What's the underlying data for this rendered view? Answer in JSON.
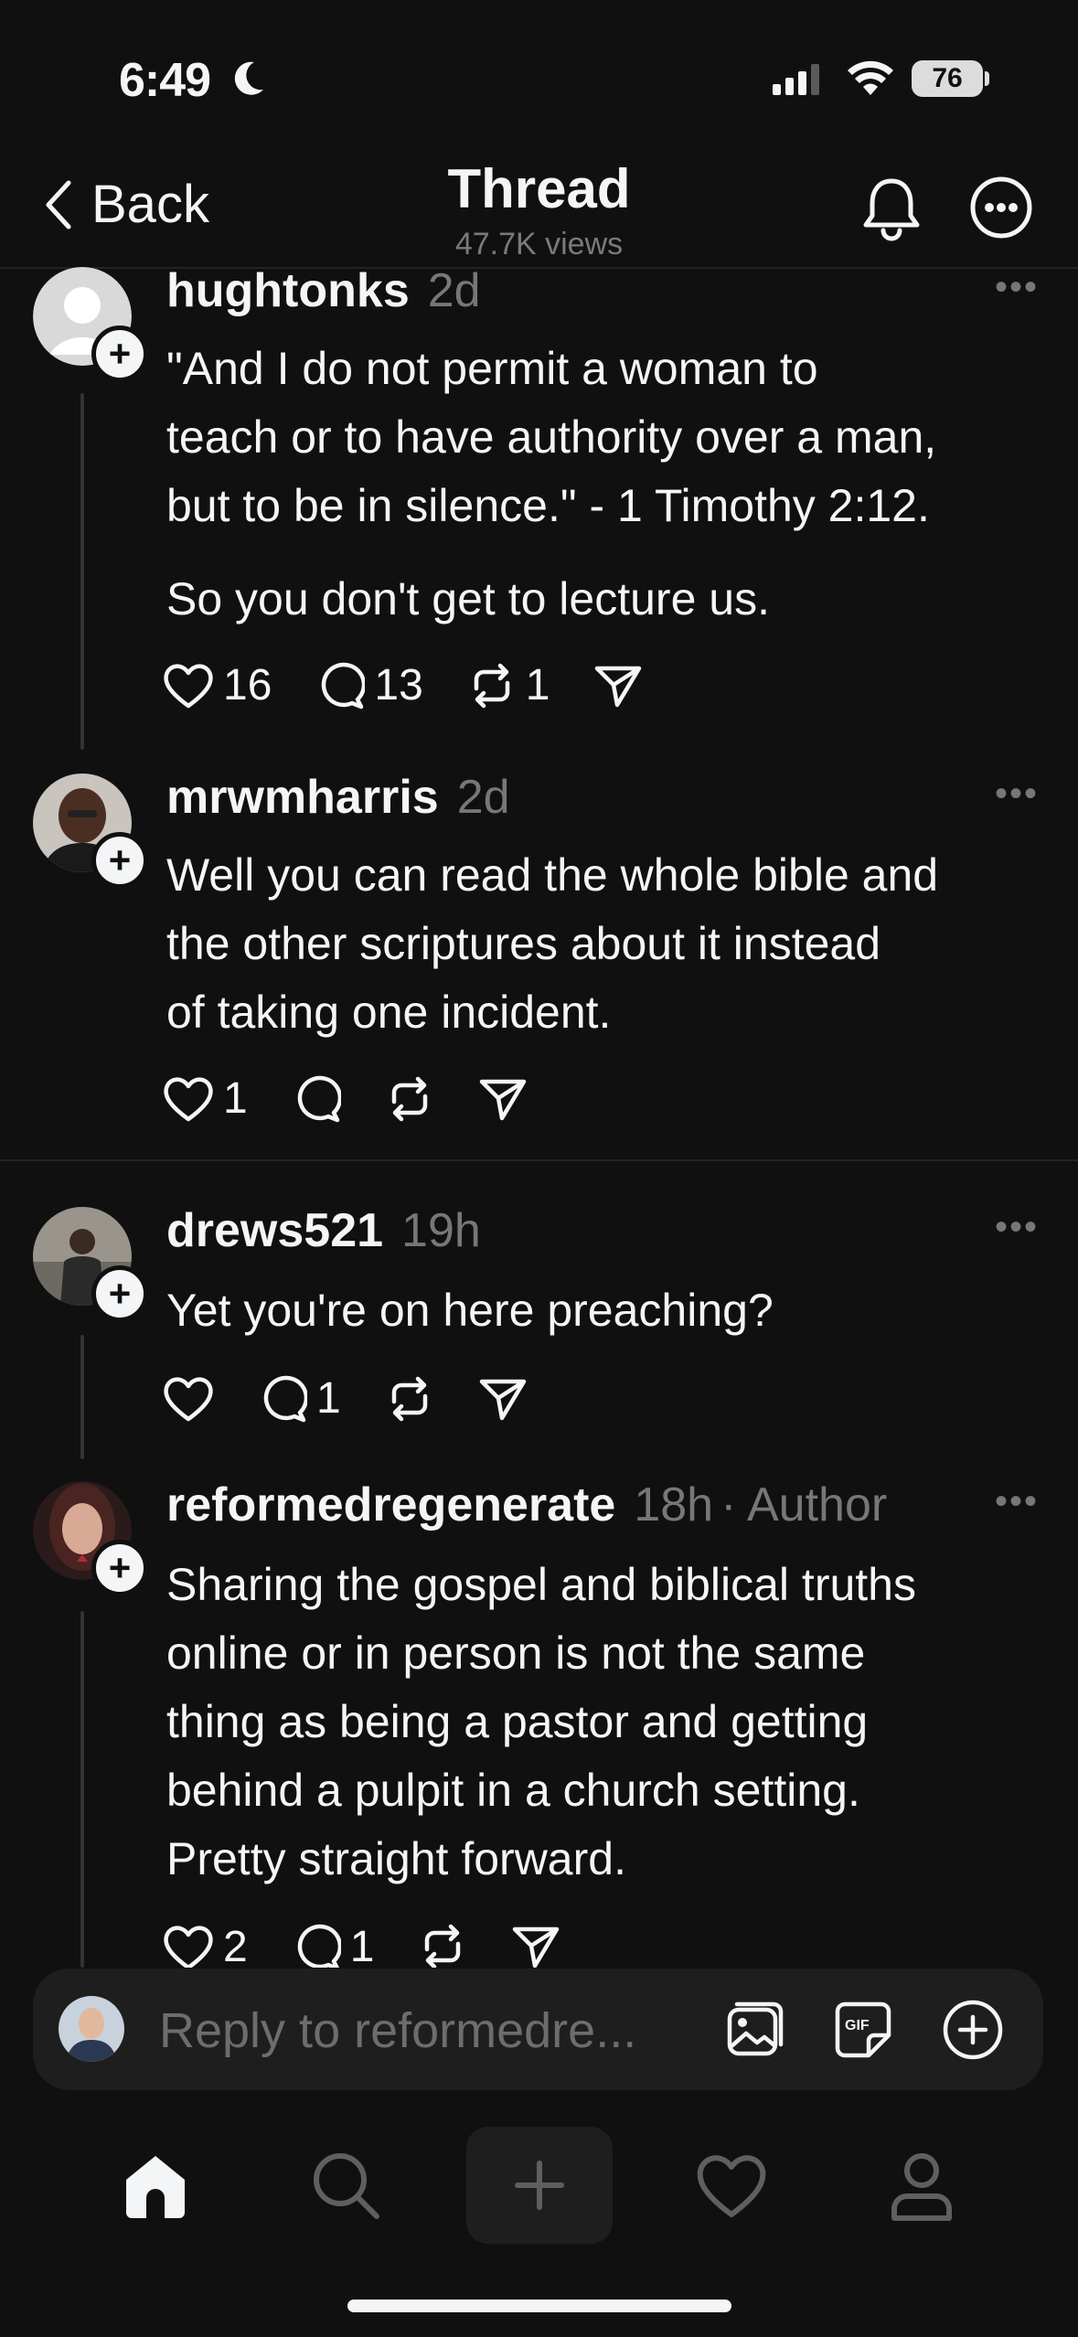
{
  "status_bar": {
    "time": "6:49",
    "battery": "76"
  },
  "header": {
    "back_label": "Back",
    "title": "Thread",
    "views": "47.7K views"
  },
  "posts": [
    {
      "username": "hughtonks",
      "time": "2d",
      "author_tag": "",
      "text": "\"And I do not permit a woman to\nteach or to have authority over a man,\nbut to be in silence.\" - 1 Timothy 2:12.",
      "text2": "So you don't get to lecture us.",
      "likes": "16",
      "replies": "13",
      "reposts": "1"
    },
    {
      "username": "mrwmharris",
      "time": "2d",
      "author_tag": "",
      "text": "Well you can read the whole bible and\nthe other scriptures about it instead\nof taking one incident.",
      "likes": "1",
      "replies": "",
      "reposts": ""
    },
    {
      "username": "drews521",
      "time": "19h",
      "author_tag": "",
      "text": "Yet you're on here preaching?",
      "likes": "",
      "replies": "1",
      "reposts": ""
    },
    {
      "username": "reformedregenerate",
      "time": "18h",
      "author_tag": "· Author",
      "text": "Sharing the gospel and biblical truths\nonline or in person is not the same\nthing as being a pastor and getting\nbehind a pulpit in a church setting.\nPretty straight forward.",
      "likes": "2",
      "replies": "1",
      "reposts": ""
    }
  ],
  "composer": {
    "placeholder": "Reply to reformedre..."
  },
  "icons": {
    "follow_badge": "+",
    "post_more": "•••"
  },
  "colors": {
    "background": "#101010",
    "text": "#f3f5f7",
    "muted": "#777777",
    "surface": "#1e1e1e"
  }
}
